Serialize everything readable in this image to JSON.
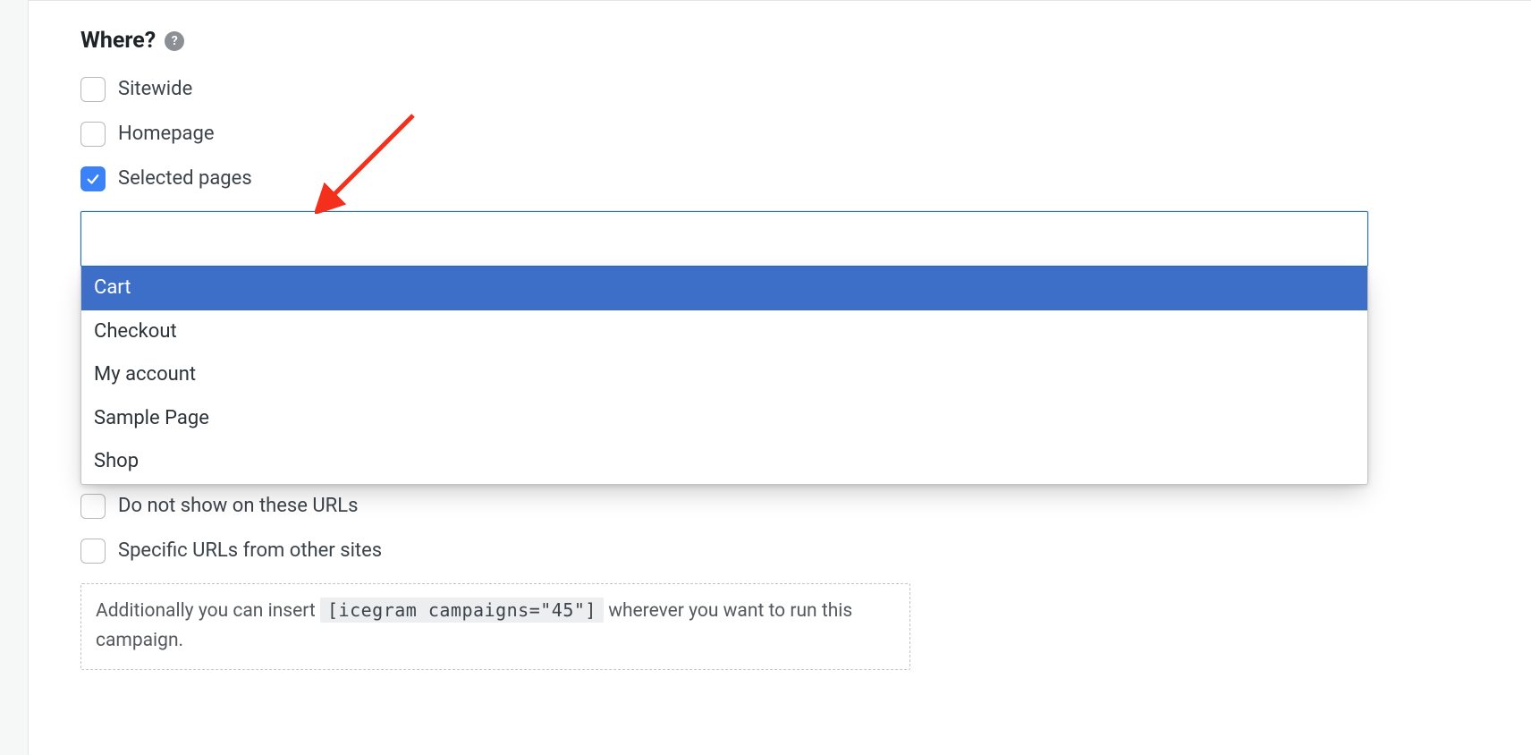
{
  "section": {
    "title": "Where?",
    "help_icon": "?"
  },
  "options": {
    "sitewide": {
      "label": "Sitewide",
      "checked": false
    },
    "homepage": {
      "label": "Homepage",
      "checked": false
    },
    "selected_pages": {
      "label": "Selected pages",
      "checked": true
    },
    "do_not_show": {
      "label": "Do not show on these URLs",
      "checked": false
    },
    "specific_urls": {
      "label": "Specific URLs from other sites",
      "checked": false
    }
  },
  "page_select": {
    "input_value": "",
    "highlighted": "Cart",
    "items": [
      "Cart",
      "Checkout",
      "My account",
      "Sample Page",
      "Shop"
    ]
  },
  "hint": {
    "before": "Additionally you can insert ",
    "code": "[icegram campaigns=\"45\"]",
    "after": " wherever you want to run this campaign."
  },
  "annotation": {
    "arrow_color": "#f4301c"
  }
}
